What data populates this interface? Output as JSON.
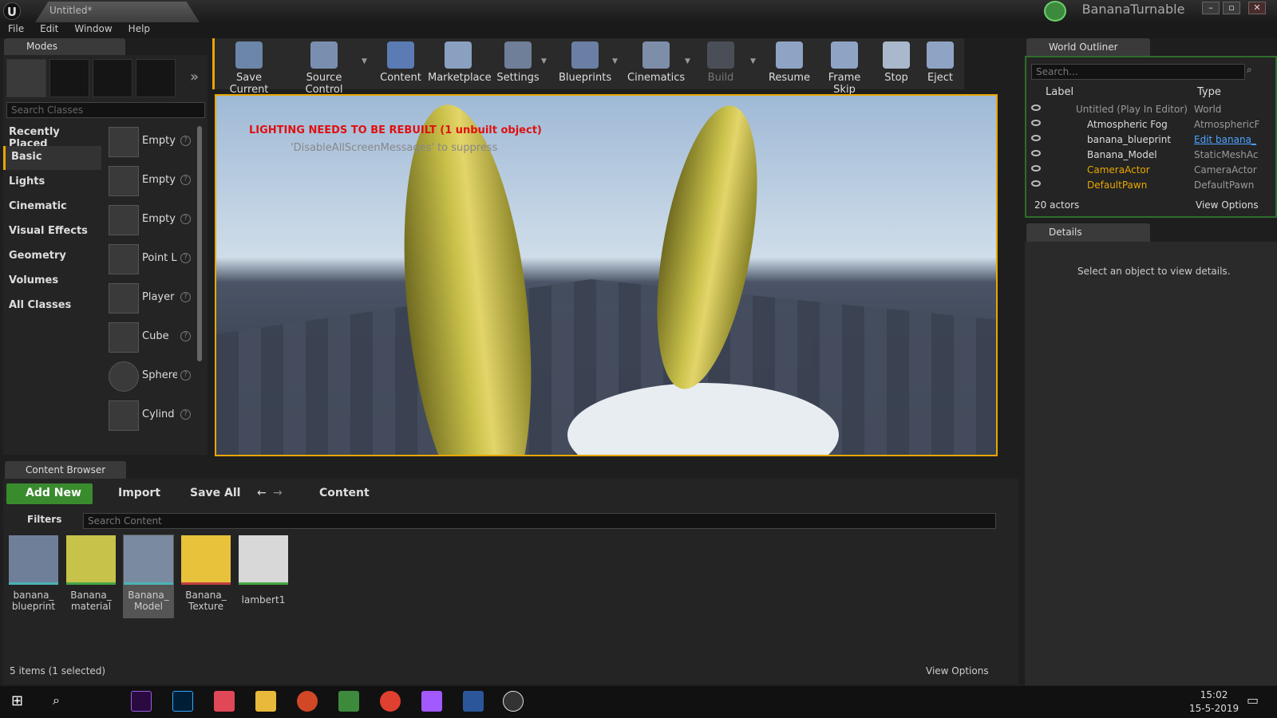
{
  "window": {
    "doc_tab": "Untitled*",
    "project": "BananaTurnable"
  },
  "menu": [
    "File",
    "Edit",
    "Window",
    "Help"
  ],
  "modes": {
    "tab": "Modes",
    "search_placeholder": "Search Classes",
    "categories": [
      "Recently Placed",
      "Basic",
      "Lights",
      "Cinematic",
      "Visual Effects",
      "Geometry",
      "Volumes",
      "All Classes"
    ],
    "classes": [
      "Empty",
      "Empty",
      "Empty",
      "Point L",
      "Player",
      "Cube",
      "Sphere",
      "Cylind"
    ]
  },
  "toolbar": {
    "buttons": [
      "Save Current",
      "Source Control",
      "Content",
      "Marketplace",
      "Settings",
      "Blueprints",
      "Cinematics",
      "Build",
      "Resume",
      "Frame Skip",
      "Stop",
      "Eject"
    ]
  },
  "viewport": {
    "warning": "LIGHTING NEEDS TO BE REBUILT (1 unbuilt object)",
    "hint": "'DisableAllScreenMessages' to suppress"
  },
  "outliner": {
    "tab": "World Outliner",
    "search_placeholder": "Search...",
    "col_label": "Label",
    "col_type": "Type",
    "rows": [
      {
        "name": "Untitled (Play In Editor)",
        "type": "World"
      },
      {
        "name": "Atmospheric Fog",
        "type": "AtmosphericF"
      },
      {
        "name": "banana_blueprint",
        "type": "Edit banana_"
      },
      {
        "name": "Banana_Model",
        "type": "StaticMeshAc"
      },
      {
        "name": "CameraActor",
        "type": "CameraActor"
      },
      {
        "name": "DefaultPawn",
        "type": "DefaultPawn"
      }
    ],
    "count": "20 actors",
    "view_options": "View Options"
  },
  "details": {
    "tab": "Details",
    "message": "Select an object to view details."
  },
  "content_browser": {
    "tab": "Content Browser",
    "add_new": "Add New",
    "import": "Import",
    "save_all": "Save All",
    "path": "Content",
    "filters": "Filters",
    "search_placeholder": "Search Content",
    "assets": [
      {
        "l1": "banana_",
        "l2": "blueprint"
      },
      {
        "l1": "Banana_",
        "l2": "material"
      },
      {
        "l1": "Banana_",
        "l2": "Model"
      },
      {
        "l1": "Banana_",
        "l2": "Texture"
      },
      {
        "l1": "lambert1",
        "l2": ""
      }
    ],
    "status": "5 items (1 selected)",
    "view_options": "View Options"
  },
  "taskbar": {
    "time": "15:02",
    "date": "15-5-2019"
  },
  "colors": {
    "accent": "#e9a700",
    "add_new": "#3a8b2e",
    "warning": "#e01010"
  }
}
